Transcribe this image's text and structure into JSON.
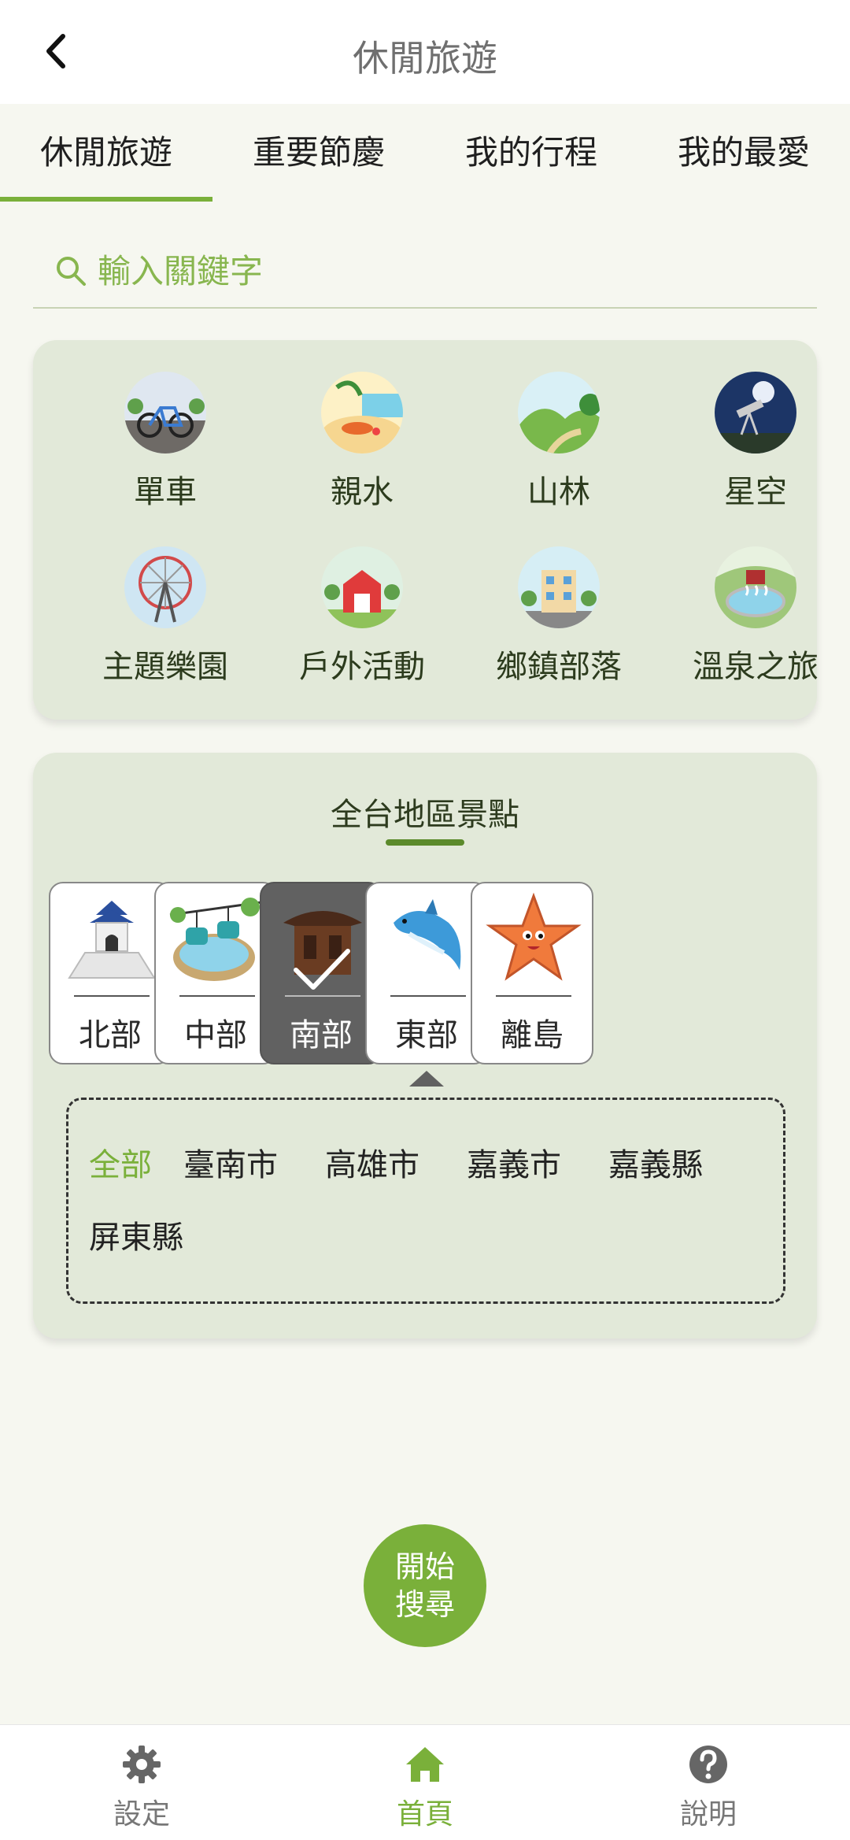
{
  "header": {
    "title": "休閒旅遊",
    "back_icon": "chevron-left-icon"
  },
  "tabs": [
    {
      "label": "休閒旅遊",
      "active": true
    },
    {
      "label": "重要節慶",
      "active": false
    },
    {
      "label": "我的行程",
      "active": false
    },
    {
      "label": "我的最愛",
      "active": false
    }
  ],
  "search": {
    "placeholder": "輸入關鍵字",
    "value": "",
    "icon": "search-icon"
  },
  "categories": [
    {
      "label": "單車",
      "icon": "bicycle-icon"
    },
    {
      "label": "親水",
      "icon": "beach-icon"
    },
    {
      "label": "山林",
      "icon": "mountain-icon"
    },
    {
      "label": "星空",
      "icon": "telescope-icon"
    },
    {
      "label": "主題樂園",
      "icon": "ferris-wheel-icon"
    },
    {
      "label": "戶外活動",
      "icon": "barn-icon"
    },
    {
      "label": "鄉鎮部落",
      "icon": "town-icon"
    },
    {
      "label": "溫泉之旅",
      "icon": "hot-spring-icon"
    }
  ],
  "region_section": {
    "title": "全台地區景點",
    "regions": [
      {
        "label": "北部",
        "icon": "memorial-hall-icon",
        "selected": false
      },
      {
        "label": "中部",
        "icon": "cable-car-icon",
        "selected": false
      },
      {
        "label": "南部",
        "icon": "temple-icon",
        "selected": true
      },
      {
        "label": "東部",
        "icon": "dolphin-icon",
        "selected": false
      },
      {
        "label": "離島",
        "icon": "starfish-icon",
        "selected": false
      }
    ],
    "subregions": [
      {
        "label": "全部",
        "active": true
      },
      {
        "label": "臺南市",
        "active": false
      },
      {
        "label": "高雄市",
        "active": false
      },
      {
        "label": "嘉義市",
        "active": false
      },
      {
        "label": "嘉義縣",
        "active": false
      },
      {
        "label": "屏東縣",
        "active": false
      }
    ]
  },
  "start_button": {
    "line1": "開始",
    "line2": "搜尋"
  },
  "bottom_nav": [
    {
      "label": "設定",
      "icon": "gear-icon",
      "active": false
    },
    {
      "label": "首頁",
      "icon": "home-icon",
      "active": true
    },
    {
      "label": "說明",
      "icon": "help-icon",
      "active": false
    }
  ],
  "colors": {
    "accent": "#7ab03a",
    "card_bg": "#e2e9d9",
    "page_bg": "#f6f7f0",
    "selected_region": "#616161"
  }
}
